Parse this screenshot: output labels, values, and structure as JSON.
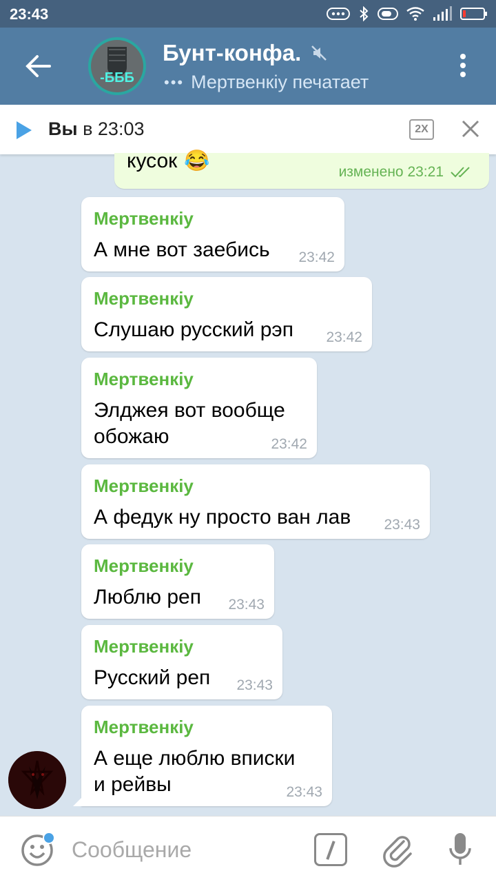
{
  "status_bar": {
    "time": "23:43"
  },
  "header": {
    "title": "Бунт-конфа.",
    "avatar_text": "-БББ",
    "typing_dots": "•••",
    "status": "Мертвенкіу печатает"
  },
  "player": {
    "sender": "Вы",
    "time_text": " в 23:03",
    "speed": "2X"
  },
  "own_message": {
    "text": "кусок",
    "emoji": "😂",
    "meta": "изменено 23:21"
  },
  "messages": [
    {
      "name": "Мертвенкіу",
      "lines": [
        "А мне вот заебись"
      ],
      "time": "23:42"
    },
    {
      "name": "Мертвенкіу",
      "lines": [
        "Слушаю русский рэп"
      ],
      "time": "23:42"
    },
    {
      "name": "Мертвенкіу",
      "lines": [
        "Элджея вот вообще",
        "обожаю"
      ],
      "time": "23:42"
    },
    {
      "name": "Мертвенкіу",
      "lines": [
        "А федук ну просто ван лав"
      ],
      "time": "23:43"
    },
    {
      "name": "Мертвенкіу",
      "lines": [
        "Люблю реп"
      ],
      "time": "23:43"
    },
    {
      "name": "Мертвенкіу",
      "lines": [
        "Русский реп"
      ],
      "time": "23:43"
    },
    {
      "name": "Мертвенкіу",
      "lines": [
        "А еще люблю вписки",
        "и рейвы"
      ],
      "time": "23:43"
    }
  ],
  "input": {
    "placeholder": "Сообщение"
  },
  "colors": {
    "header": "#527da3",
    "status_bar": "#45617e",
    "name": "#5bb840",
    "own_bubble": "#effdde",
    "background": "#d7e3ee",
    "accent": "#4aa2e5"
  }
}
